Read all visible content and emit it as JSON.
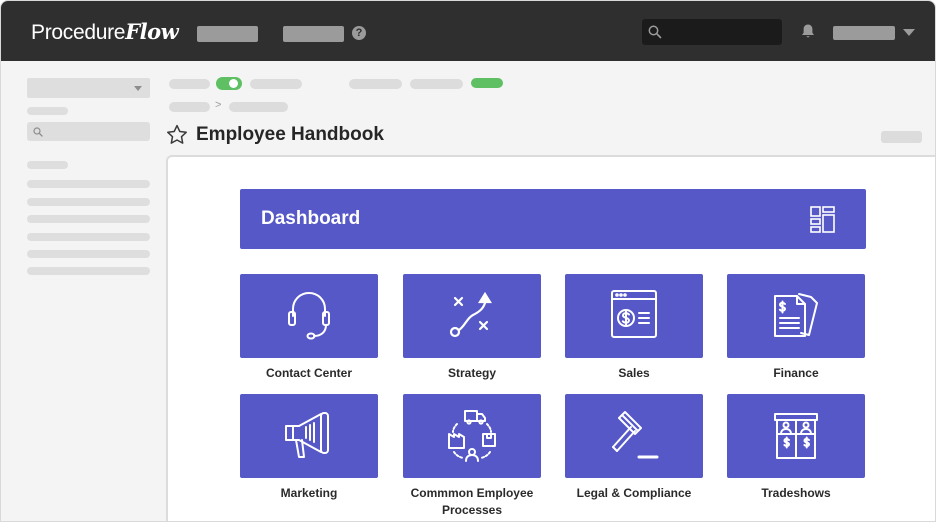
{
  "app": {
    "logo_main": "Procedure",
    "logo_accent": "Flow",
    "help_glyph": "?"
  },
  "page": {
    "title": "Employee Handbook",
    "breadcrumb_separator": ">"
  },
  "dashboard": {
    "title": "Dashboard",
    "tiles": [
      {
        "label": "Contact Center",
        "icon": "headset-icon"
      },
      {
        "label": "Strategy",
        "icon": "strategy-icon"
      },
      {
        "label": "Sales",
        "icon": "sales-icon"
      },
      {
        "label": "Finance",
        "icon": "finance-icon"
      },
      {
        "label": "Marketing",
        "icon": "megaphone-icon"
      },
      {
        "label": "Commmon Employee Processes",
        "icon": "process-cycle-icon"
      },
      {
        "label": "Legal & Compliance",
        "icon": "gavel-icon"
      },
      {
        "label": "Tradeshows",
        "icon": "tradeshow-booth-icon"
      }
    ]
  },
  "colors": {
    "topbar": "#2f2f2f",
    "accent_purple": "#5558c6",
    "toggle_green": "#5fbf63",
    "placeholder_gray": "#dcdcdc"
  }
}
